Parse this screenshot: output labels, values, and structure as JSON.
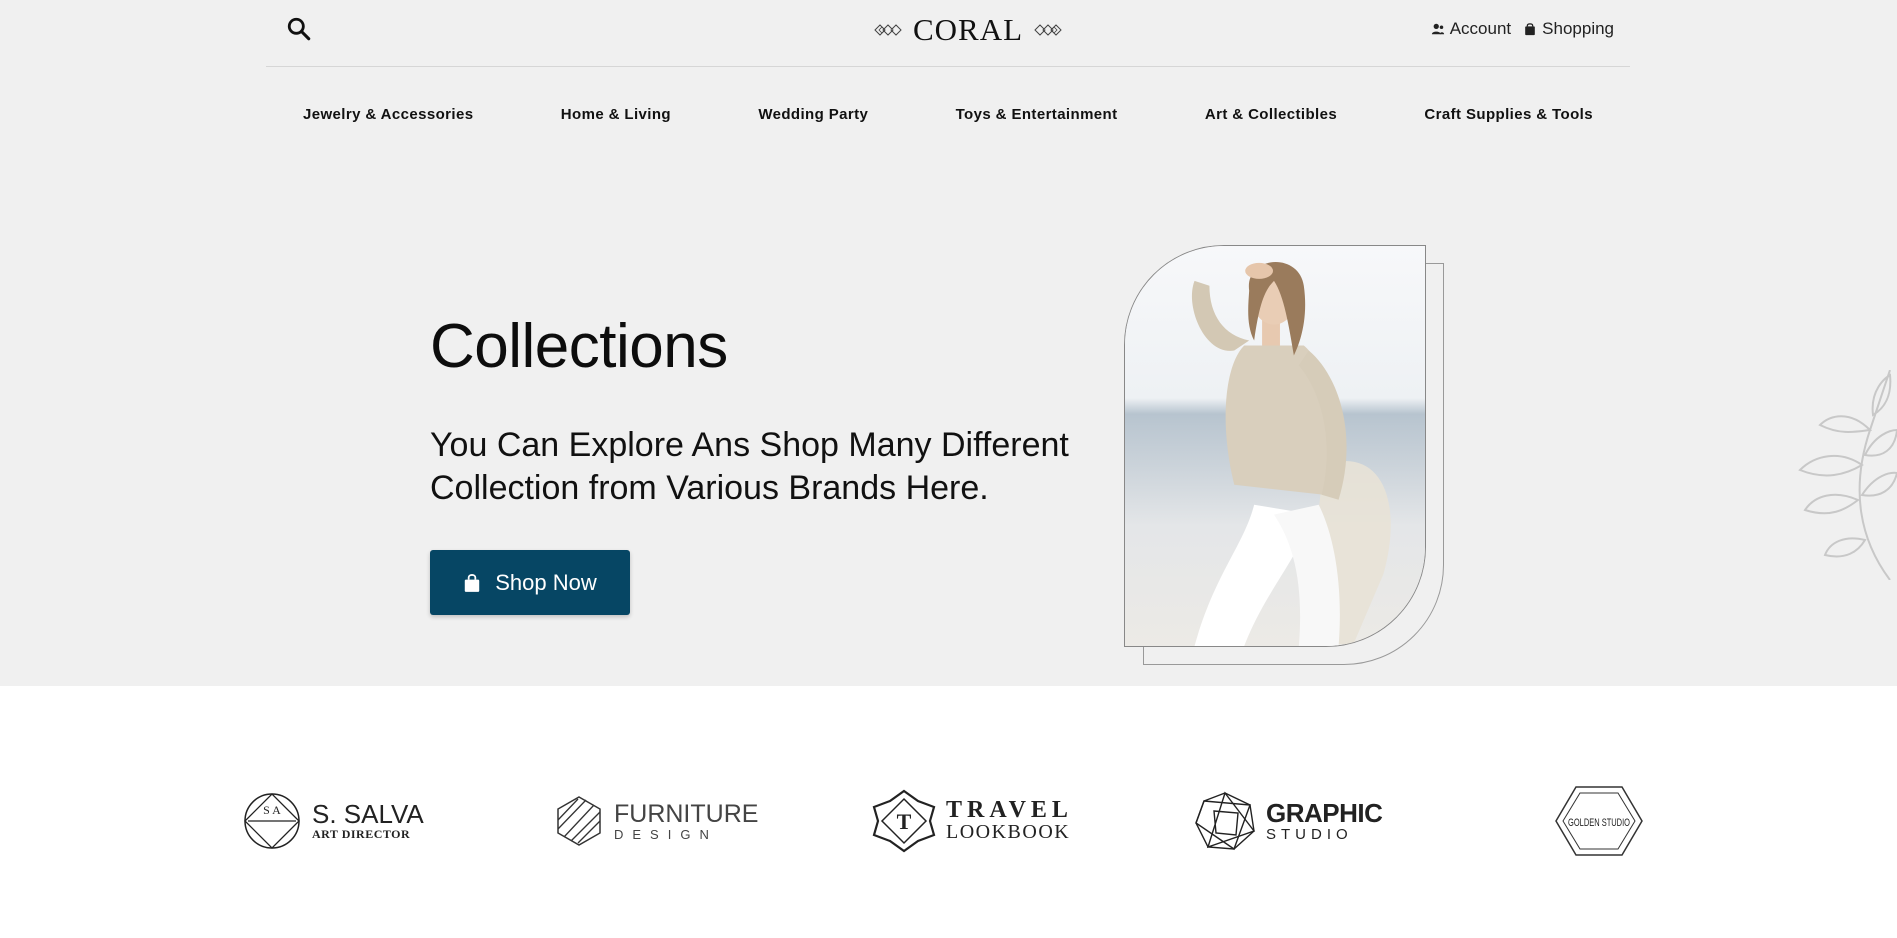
{
  "header": {
    "logo_text": "CORAL",
    "account_label": "Account",
    "shopping_label": "Shopping"
  },
  "nav": {
    "items": [
      {
        "label": "Jewelry & Accessories"
      },
      {
        "label": "Home & Living"
      },
      {
        "label": "Wedding Party"
      },
      {
        "label": "Toys & Entertainment"
      },
      {
        "label": "Art & Collectibles"
      },
      {
        "label": "Craft Supplies & Tools"
      }
    ]
  },
  "hero": {
    "title": "Collections",
    "subtitle": "You Can Explore Ans Shop Many Different Collection from Various Brands Here.",
    "button_label": "Shop Now",
    "button_color": "#064664"
  },
  "brands": [
    {
      "name": "S. SALVA",
      "tagline": "ART DIRECTOR",
      "mark": "S A"
    },
    {
      "name": "FURNITURE",
      "tagline": "DESIGN"
    },
    {
      "name": "TRAVEL",
      "tagline": "LOOKBOOK",
      "mark": "T"
    },
    {
      "name": "GRAPHIC",
      "tagline": "STUDIO"
    },
    {
      "name": "GOLDEN STUDIO"
    }
  ],
  "icons": {
    "search": "search-icon",
    "account": "user-icon",
    "shopping": "bag-icon"
  }
}
